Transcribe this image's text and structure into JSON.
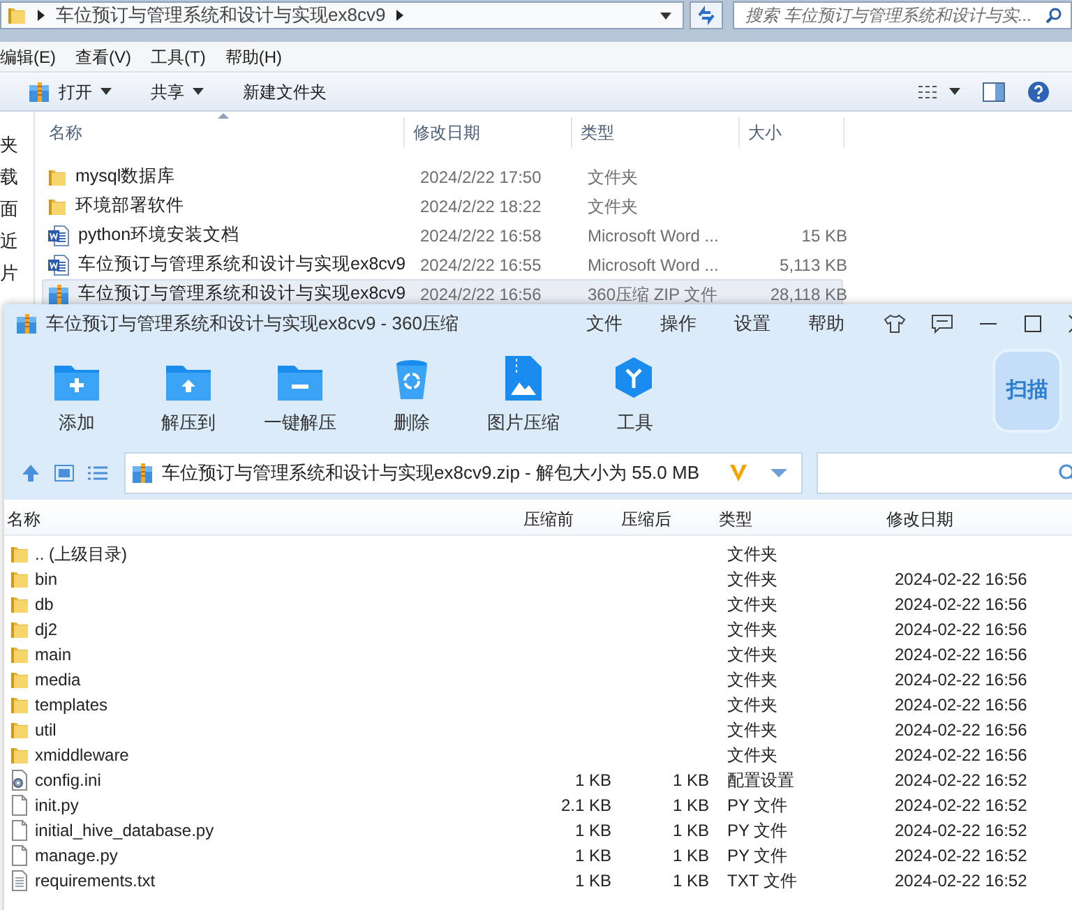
{
  "explorer": {
    "breadcrumb": "车位预订与管理系统和设计与实现ex8cv9",
    "search": {
      "placeholder": "搜索 车位预订与管理系统和设计与实..."
    },
    "menu": [
      "编辑(E)",
      "查看(V)",
      "工具(T)",
      "帮助(H)"
    ],
    "toolbar": [
      {
        "label": "打开",
        "dropdown": true
      },
      {
        "label": "共享",
        "dropdown": true
      },
      {
        "label": "新建文件夹",
        "dropdown": false
      }
    ],
    "nav_pane": [
      "夹",
      "载",
      "面",
      "近",
      "片"
    ],
    "columns": [
      "名称",
      "修改日期",
      "类型",
      "大小"
    ],
    "files": [
      {
        "kind": "folder",
        "name": "mysql数据库",
        "modified": "2024/2/22 17:50",
        "type": "文件夹",
        "selected": false
      },
      {
        "kind": "folder",
        "name": "环境部署软件",
        "modified": "2024/2/22 18:22",
        "type": "文件夹",
        "selected": false
      },
      {
        "kind": "word",
        "name": "python环境安装文档",
        "modified": "2024/2/22 16:58",
        "type": "Microsoft Word ...",
        "size": "15 KB",
        "selected": false
      },
      {
        "kind": "word",
        "name": "车位预订与管理系统和设计与实现ex8cv9",
        "modified": "2024/2/22 16:55",
        "type": "Microsoft Word ...",
        "size": "5,113 KB",
        "selected": false
      },
      {
        "kind": "zip",
        "name": "车位预订与管理系统和设计与实现ex8cv9",
        "modified": "2024/2/22 16:56",
        "type": "360压缩 ZIP 文件",
        "size": "28,118 KB",
        "selected": true
      }
    ]
  },
  "archiver": {
    "title": "车位预订与管理系统和设计与实现ex8cv9 - 360压缩",
    "menu": [
      "文件",
      "操作",
      "设置",
      "帮助"
    ],
    "tools": [
      {
        "kind": "add",
        "label": "添加"
      },
      {
        "kind": "extract_to",
        "label": "解压到"
      },
      {
        "kind": "extract",
        "label": "一键解压"
      },
      {
        "kind": "delete",
        "label": "删除"
      },
      {
        "kind": "image",
        "label": "图片压缩"
      },
      {
        "kind": "tools",
        "label": "工具"
      }
    ],
    "scan": "扫描",
    "path": "车位预订与管理系统和设计与实现ex8cv9.zip - 解包大小为 55.0 MB",
    "columns": [
      "名称",
      "压缩前",
      "压缩后",
      "类型",
      "修改日期"
    ],
    "entries": [
      {
        "kind": "folder",
        "name": ".. (上级目录)",
        "type": "文件夹"
      },
      {
        "kind": "folder",
        "name": "bin",
        "type": "文件夹",
        "modified": "2024-02-22 16:56"
      },
      {
        "kind": "folder",
        "name": "db",
        "type": "文件夹",
        "modified": "2024-02-22 16:56"
      },
      {
        "kind": "folder",
        "name": "dj2",
        "type": "文件夹",
        "modified": "2024-02-22 16:56"
      },
      {
        "kind": "folder",
        "name": "main",
        "type": "文件夹",
        "modified": "2024-02-22 16:56"
      },
      {
        "kind": "folder",
        "name": "media",
        "type": "文件夹",
        "modified": "2024-02-22 16:56"
      },
      {
        "kind": "folder",
        "name": "templates",
        "type": "文件夹",
        "modified": "2024-02-22 16:56"
      },
      {
        "kind": "folder",
        "name": "util",
        "type": "文件夹",
        "modified": "2024-02-22 16:56"
      },
      {
        "kind": "folder",
        "name": "xmiddleware",
        "type": "文件夹",
        "modified": "2024-02-22 16:56"
      },
      {
        "kind": "config",
        "name": "config.ini",
        "original_size": "1 KB",
        "compressed_size": "1 KB",
        "type": "配置设置",
        "modified": "2024-02-22 16:52"
      },
      {
        "kind": "file",
        "name": "init.py",
        "original_size": "2.1 KB",
        "compressed_size": "1 KB",
        "type": "PY 文件",
        "modified": "2024-02-22 16:52"
      },
      {
        "kind": "file",
        "name": "initial_hive_database.py",
        "original_size": "1 KB",
        "compressed_size": "1 KB",
        "type": "PY 文件",
        "modified": "2024-02-22 16:52"
      },
      {
        "kind": "file",
        "name": "manage.py",
        "original_size": "1 KB",
        "compressed_size": "1 KB",
        "type": "PY 文件",
        "modified": "2024-02-22 16:52"
      },
      {
        "kind": "text",
        "name": "requirements.txt",
        "original_size": "1 KB",
        "compressed_size": "1 KB",
        "type": "TXT 文件",
        "modified": "2024-02-22 16:52"
      }
    ]
  }
}
